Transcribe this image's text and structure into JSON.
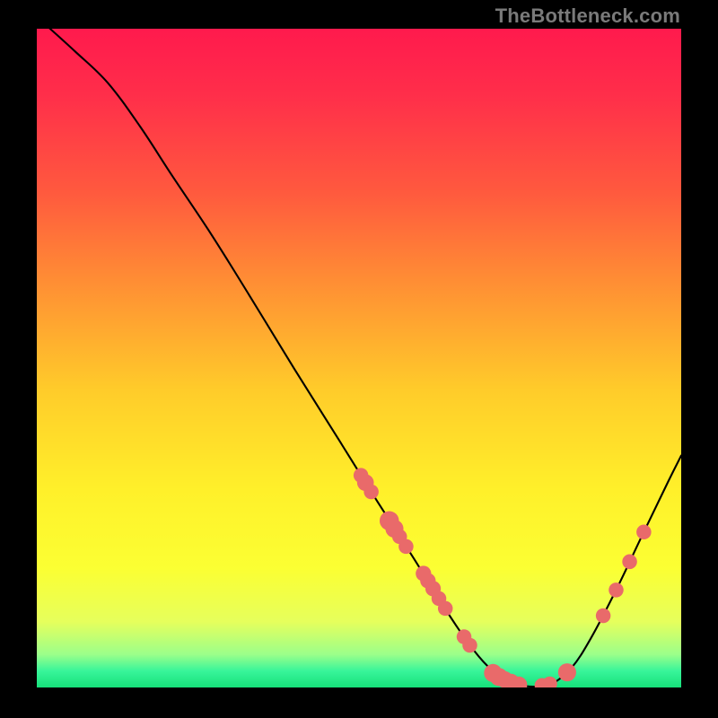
{
  "watermark": "TheBottleneck.com",
  "chart_data": {
    "type": "line",
    "title": "",
    "xlabel": "",
    "ylabel": "",
    "xlim": [
      0,
      100
    ],
    "ylim": [
      0,
      100
    ],
    "gradient_stops": [
      {
        "offset": 0.0,
        "color": "#ff1a4d"
      },
      {
        "offset": 0.1,
        "color": "#ff2e4a"
      },
      {
        "offset": 0.25,
        "color": "#ff5a3e"
      },
      {
        "offset": 0.4,
        "color": "#ff9433"
      },
      {
        "offset": 0.55,
        "color": "#ffcc2a"
      },
      {
        "offset": 0.7,
        "color": "#fff02a"
      },
      {
        "offset": 0.82,
        "color": "#fbff33"
      },
      {
        "offset": 0.9,
        "color": "#e6ff5c"
      },
      {
        "offset": 0.95,
        "color": "#9bff8a"
      },
      {
        "offset": 0.975,
        "color": "#38f59a"
      },
      {
        "offset": 1.0,
        "color": "#16e07a"
      }
    ],
    "curve": [
      {
        "x": 1.5,
        "y": 100.5
      },
      {
        "x": 6,
        "y": 96.5
      },
      {
        "x": 11,
        "y": 91.8
      },
      {
        "x": 16,
        "y": 85.2
      },
      {
        "x": 21,
        "y": 77.7
      },
      {
        "x": 27,
        "y": 68.9
      },
      {
        "x": 33,
        "y": 59.5
      },
      {
        "x": 40,
        "y": 48.3
      },
      {
        "x": 47,
        "y": 37.4
      },
      {
        "x": 53,
        "y": 28.0
      },
      {
        "x": 58.5,
        "y": 19.6
      },
      {
        "x": 63,
        "y": 12.5
      },
      {
        "x": 67,
        "y": 6.7
      },
      {
        "x": 70,
        "y": 3.2
      },
      {
        "x": 72.5,
        "y": 1.3
      },
      {
        "x": 75,
        "y": 0.35
      },
      {
        "x": 77.5,
        "y": 0.15
      },
      {
        "x": 80,
        "y": 0.6
      },
      {
        "x": 83,
        "y": 3.0
      },
      {
        "x": 86,
        "y": 7.5
      },
      {
        "x": 90,
        "y": 15.0
      },
      {
        "x": 94,
        "y": 23.2
      },
      {
        "x": 98,
        "y": 31.3
      },
      {
        "x": 100,
        "y": 35.2
      }
    ],
    "markers": [
      {
        "x": 50.3,
        "y": 32.2,
        "r": 1.15
      },
      {
        "x": 51.0,
        "y": 31.1,
        "r": 1.3
      },
      {
        "x": 51.9,
        "y": 29.7,
        "r": 1.15
      },
      {
        "x": 54.7,
        "y": 25.3,
        "r": 1.5
      },
      {
        "x": 55.5,
        "y": 24.1,
        "r": 1.4
      },
      {
        "x": 56.3,
        "y": 22.9,
        "r": 1.15
      },
      {
        "x": 57.3,
        "y": 21.4,
        "r": 1.15
      },
      {
        "x": 60.0,
        "y": 17.3,
        "r": 1.2
      },
      {
        "x": 60.7,
        "y": 16.2,
        "r": 1.2
      },
      {
        "x": 61.5,
        "y": 15.0,
        "r": 1.2
      },
      {
        "x": 62.4,
        "y": 13.5,
        "r": 1.15
      },
      {
        "x": 63.4,
        "y": 12.0,
        "r": 1.15
      },
      {
        "x": 66.3,
        "y": 7.7,
        "r": 1.15
      },
      {
        "x": 67.2,
        "y": 6.4,
        "r": 1.15
      },
      {
        "x": 70.8,
        "y": 2.2,
        "r": 1.4
      },
      {
        "x": 71.7,
        "y": 1.6,
        "r": 1.4
      },
      {
        "x": 72.6,
        "y": 1.2,
        "r": 1.3
      },
      {
        "x": 73.6,
        "y": 0.8,
        "r": 1.3
      },
      {
        "x": 74.8,
        "y": 0.4,
        "r": 1.3
      },
      {
        "x": 78.4,
        "y": 0.3,
        "r": 1.15
      },
      {
        "x": 79.6,
        "y": 0.55,
        "r": 1.15
      },
      {
        "x": 82.3,
        "y": 2.3,
        "r": 1.4
      },
      {
        "x": 87.9,
        "y": 10.9,
        "r": 1.15
      },
      {
        "x": 89.9,
        "y": 14.8,
        "r": 1.15
      },
      {
        "x": 92.0,
        "y": 19.1,
        "r": 1.15
      },
      {
        "x": 94.2,
        "y": 23.6,
        "r": 1.15
      }
    ],
    "marker_color": "#e96a6a",
    "curve_color": "#000000",
    "curve_width": 2.1
  }
}
